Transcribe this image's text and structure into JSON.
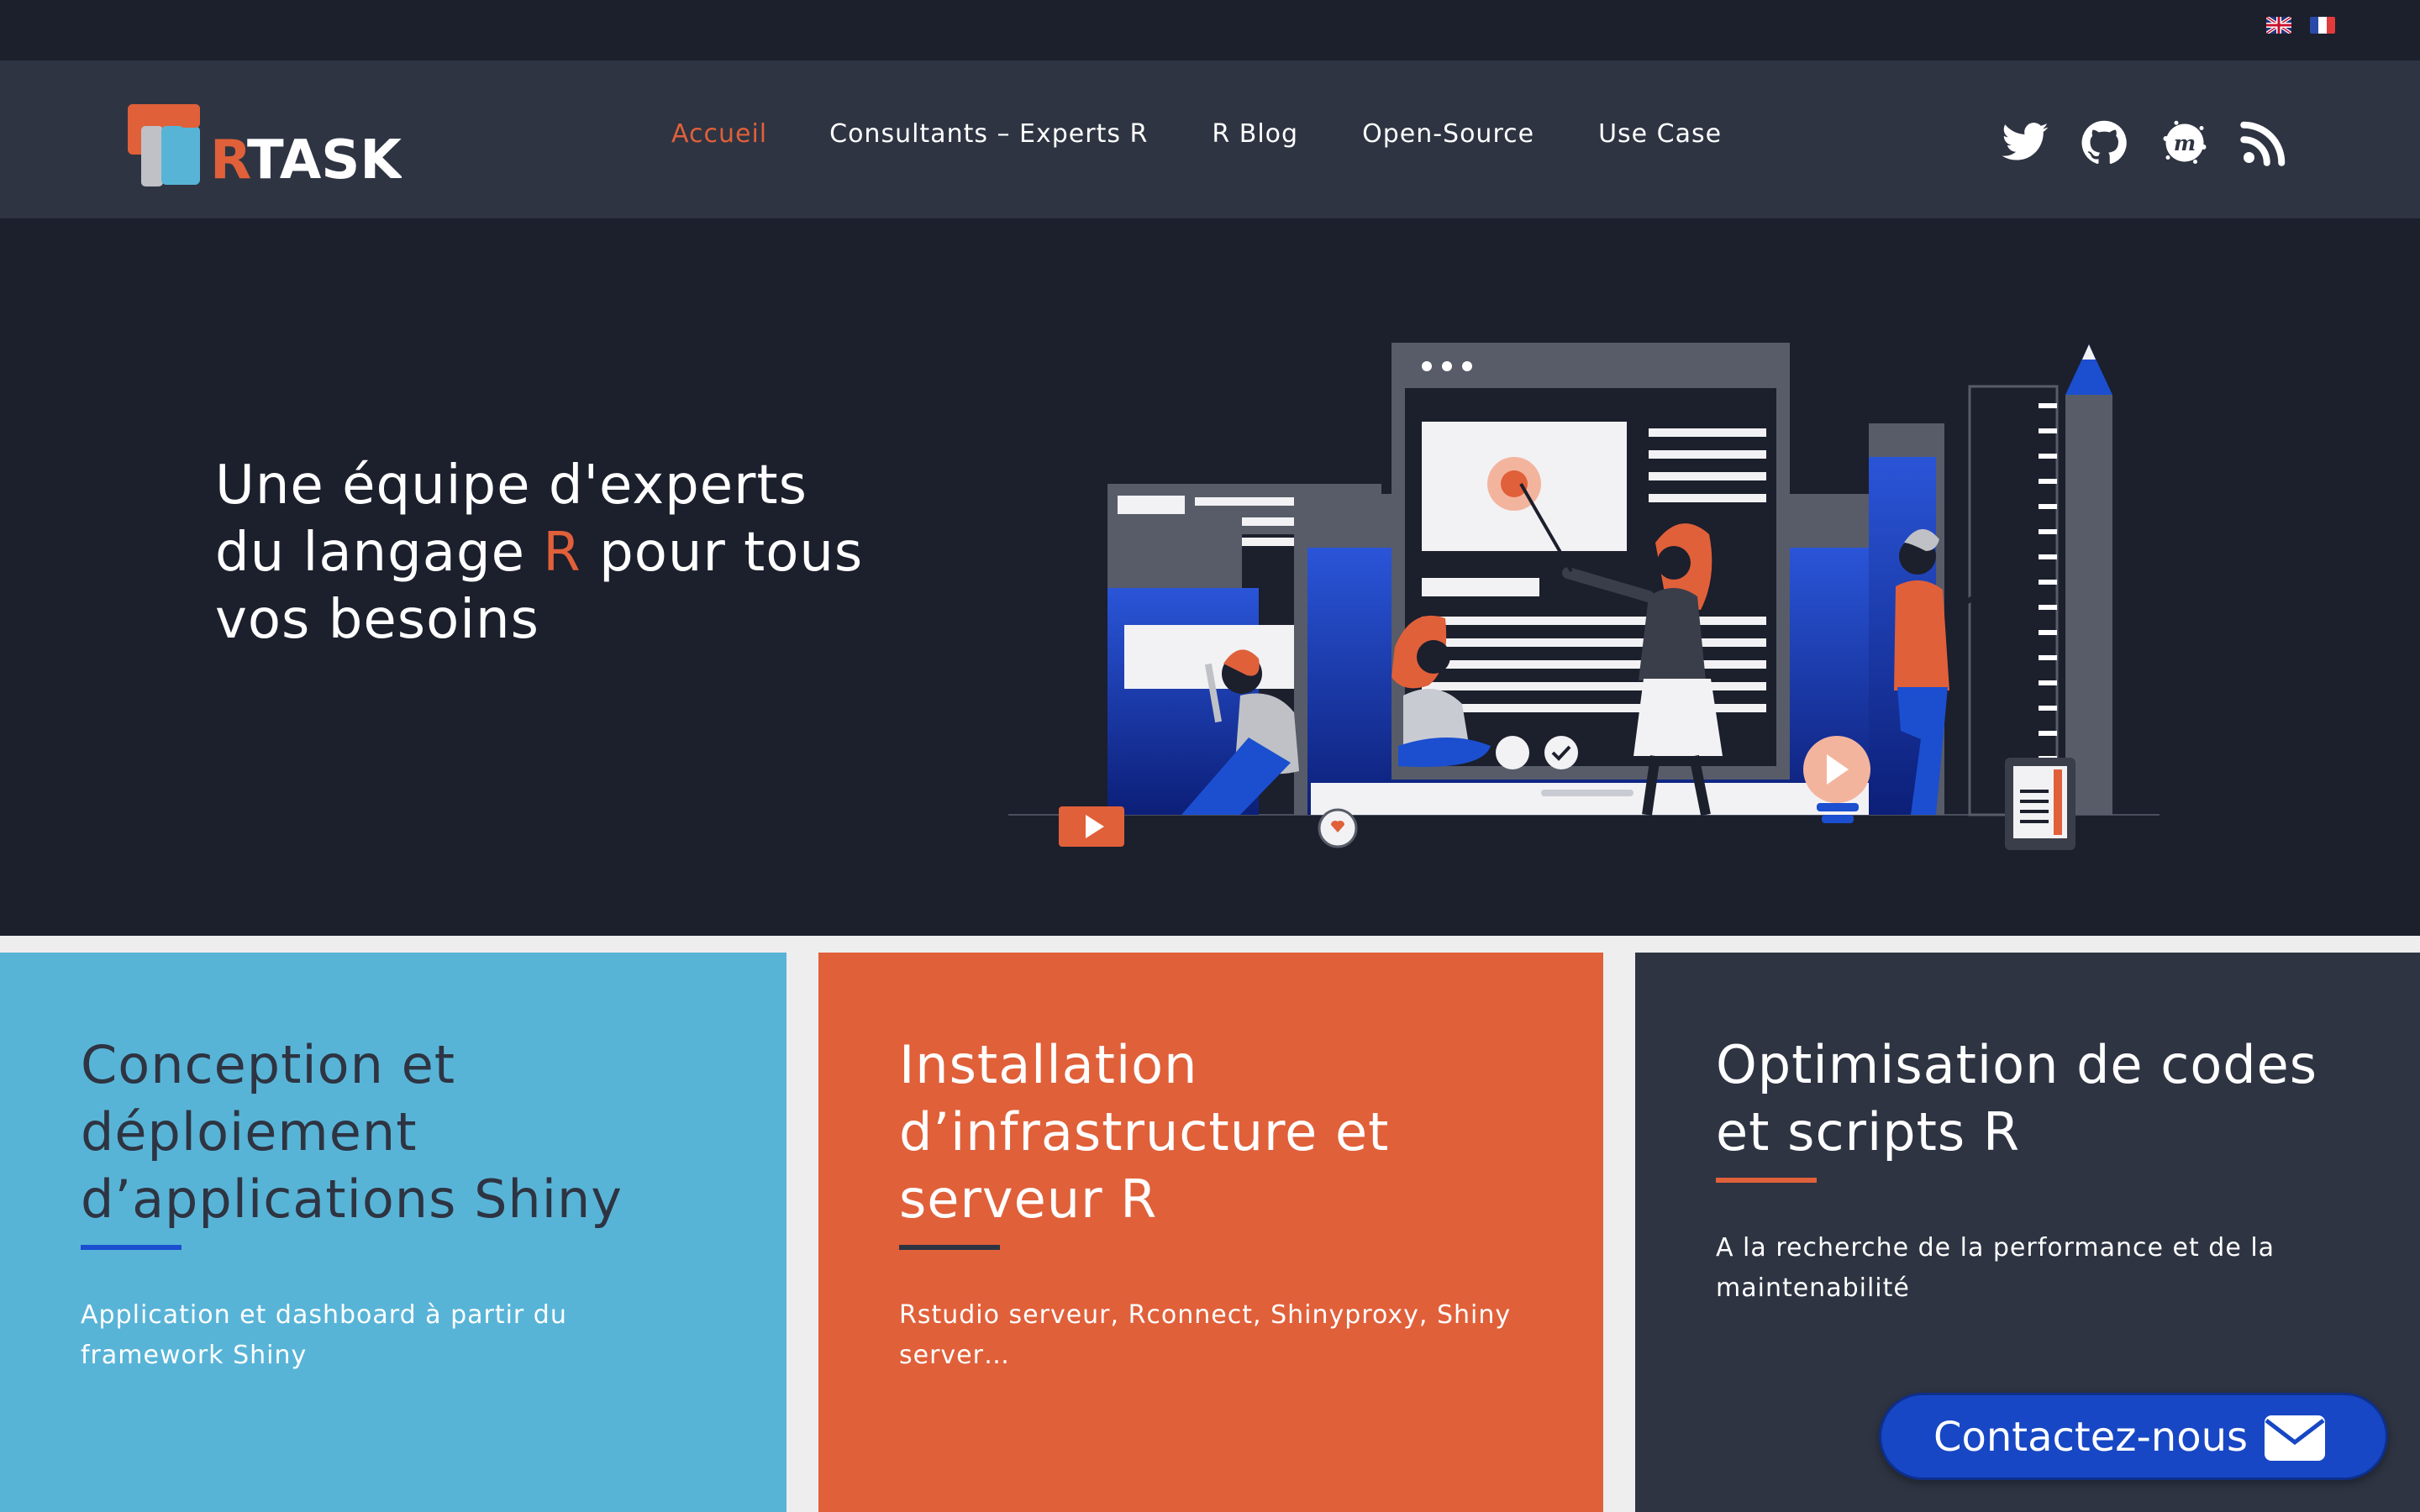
{
  "topbar": {
    "flags": [
      {
        "name": "english-flag-icon"
      },
      {
        "name": "french-flag-icon"
      }
    ]
  },
  "header": {
    "logo_text": "RTASK",
    "nav": [
      {
        "label": "Accueil",
        "active": true
      },
      {
        "label": "Consultants – Experts R",
        "active": false
      },
      {
        "label": "R Blog",
        "active": false
      },
      {
        "label": "Open-Source",
        "active": false
      },
      {
        "label": "Use Case",
        "active": false
      }
    ],
    "social": [
      "twitter-icon",
      "github-icon",
      "meetup-icon",
      "rss-icon"
    ]
  },
  "hero": {
    "title_line1": "Une équipe d'experts",
    "title_line2_pre": "du langage ",
    "title_line2_accent": "R",
    "title_line2_post": " pour tous",
    "title_line3": "vos besoins"
  },
  "cards": [
    {
      "title_lines": [
        "Conception et",
        "déploiement",
        "d’applications Shiny"
      ],
      "text_lines": [
        "Application et dashboard à partir du",
        "framework Shiny"
      ]
    },
    {
      "title_lines": [
        "Installation",
        "d’infrastructure et",
        "serveur R"
      ],
      "text_lines": [
        "Rstudio serveur, Rconnect, Shinyproxy, Shiny",
        "server…"
      ]
    },
    {
      "title_lines": [
        "Optimisation de codes",
        "et scripts R"
      ],
      "text_lines": [
        "A la recherche de la performance et de la",
        "maintenabilité"
      ]
    }
  ],
  "contact": {
    "label": "Contactez-nous",
    "icon": "envelope-icon"
  },
  "colors": {
    "accent_orange": "#e0603a",
    "accent_blue": "#58b4d7",
    "dark_bg": "#1c1f2c",
    "header_bg": "#2e3442",
    "button_blue": "#1747c4"
  }
}
